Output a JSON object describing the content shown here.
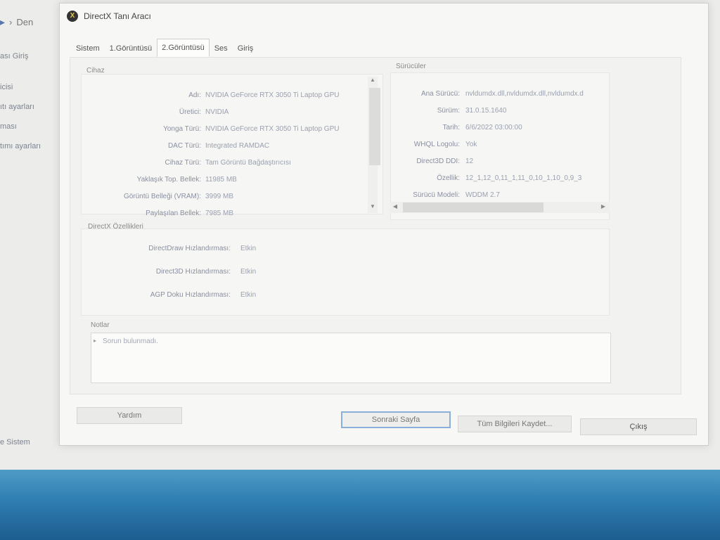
{
  "background_window": {
    "breadcrumb": [
      "Den"
    ],
    "controls": [
      "—",
      "☐",
      "✕"
    ],
    "sidebar": [
      "ası Giriş",
      "icisi",
      "ıtı ayarları",
      "ması",
      "tımı ayarları",
      "e Sistem"
    ]
  },
  "dialog": {
    "title": "DirectX Tanı Aracı",
    "tabs": [
      "Sistem",
      "1.Görüntüsü",
      "2.Görüntüsü",
      "Ses",
      "Giriş"
    ],
    "active_tab": "2.Görüntüsü",
    "device": {
      "label": "Cihaz",
      "rows": [
        {
          "label": "Adı:",
          "value": "NVIDIA GeForce RTX 3050 Ti Laptop GPU"
        },
        {
          "label": "Üretici:",
          "value": "NVIDIA"
        },
        {
          "label": "Yonga Türü:",
          "value": "NVIDIA GeForce RTX 3050 Ti Laptop GPU"
        },
        {
          "label": "DAC Türü:",
          "value": "Integrated RAMDAC"
        },
        {
          "label": "Cihaz Türü:",
          "value": "Tam Görüntü Bağdaştırıcısı"
        },
        {
          "label": "Yaklaşık Top. Bellek:",
          "value": "11985 MB"
        },
        {
          "label": "Görüntü Belleği (VRAM):",
          "value": "3999 MB"
        },
        {
          "label": "Paylaşılan Bellek:",
          "value": "7985 MB"
        }
      ]
    },
    "drivers": {
      "label": "Sürücüler",
      "rows": [
        {
          "label": "Ana Sürücü:",
          "value": "nvldumdx.dll,nvldumdx.dll,nvldumdx.d"
        },
        {
          "label": "Sürüm:",
          "value": "31.0.15.1640"
        },
        {
          "label": "Tarih:",
          "value": "6/6/2022 03:00:00"
        },
        {
          "label": "WHQL Logolu:",
          "value": "Yok"
        },
        {
          "label": "Direct3D DDI:",
          "value": "12"
        },
        {
          "label": "Özellik:",
          "value": "12_1,12_0,11_1,11_0,10_1,10_0,9_3"
        },
        {
          "label": "Sürücü Modeli:",
          "value": "WDDM 2.7"
        }
      ]
    },
    "directx_features": {
      "label": "DirectX Özellikleri",
      "rows": [
        {
          "label": "DirectDraw Hızlandırması:",
          "value": "Etkin"
        },
        {
          "label": "Direct3D Hızlandırması:",
          "value": "Etkin"
        },
        {
          "label": "AGP Doku Hızlandırması:",
          "value": "Etkin"
        }
      ]
    },
    "notes": {
      "label": "Notlar",
      "items": [
        "Sorun bulunmadı."
      ]
    },
    "buttons": {
      "help": "Yardım",
      "next_page": "Sonraki Sayfa",
      "save_all": "Tüm Bilgileri Kaydet...",
      "exit": "Çıkış"
    }
  },
  "colors": {
    "desktop": "#2e7db1",
    "dialog_bg": "#f7f7f5",
    "default_button_border": "#8ab0d8"
  }
}
